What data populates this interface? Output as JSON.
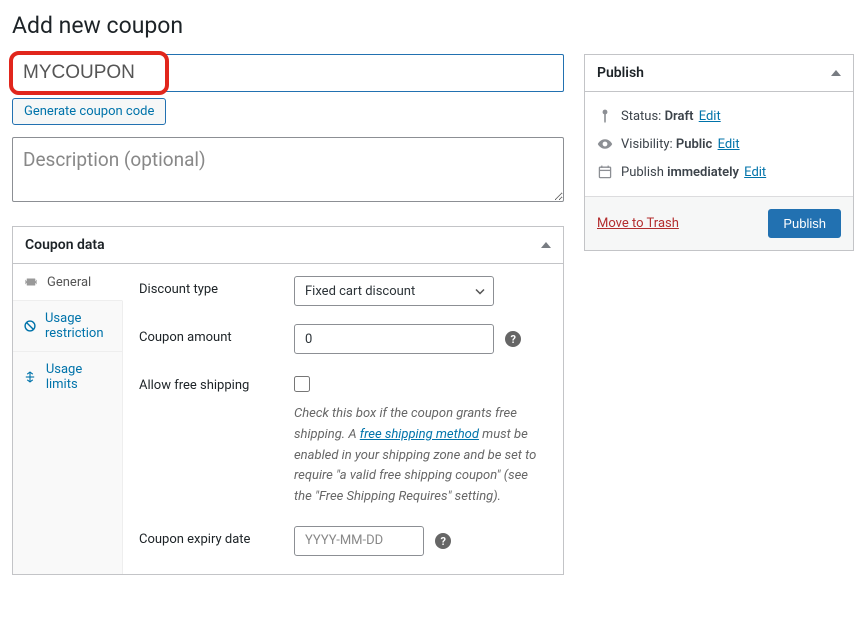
{
  "page_title": "Add new coupon",
  "coupon_code_value": "MYCOUPON",
  "generate_code_label": "Generate coupon code",
  "description_placeholder": "Description (optional)",
  "coupon_data": {
    "panel_title": "Coupon data",
    "tabs": {
      "general": "General",
      "usage_restriction": "Usage restriction",
      "usage_limits": "Usage limits"
    },
    "fields": {
      "discount_type": {
        "label": "Discount type",
        "selected": "Fixed cart discount"
      },
      "coupon_amount": {
        "label": "Coupon amount",
        "value": "0"
      },
      "allow_free_shipping": {
        "label": "Allow free shipping",
        "hint_part1": "Check this box if the coupon grants free shipping. A ",
        "hint_link": "free shipping method",
        "hint_part2": " must be enabled in your shipping zone and be set to require \"a valid free shipping coupon\" (see the \"Free Shipping Requires\" setting)."
      },
      "expiry": {
        "label": "Coupon expiry date",
        "placeholder": "YYYY-MM-DD"
      }
    }
  },
  "publish": {
    "panel_title": "Publish",
    "status_label": "Status:",
    "status_value": "Draft",
    "visibility_label": "Visibility:",
    "visibility_value": "Public",
    "schedule_label": "Publish",
    "schedule_value": "immediately",
    "edit_label": "Edit",
    "trash_label": "Move to Trash",
    "publish_button": "Publish"
  }
}
